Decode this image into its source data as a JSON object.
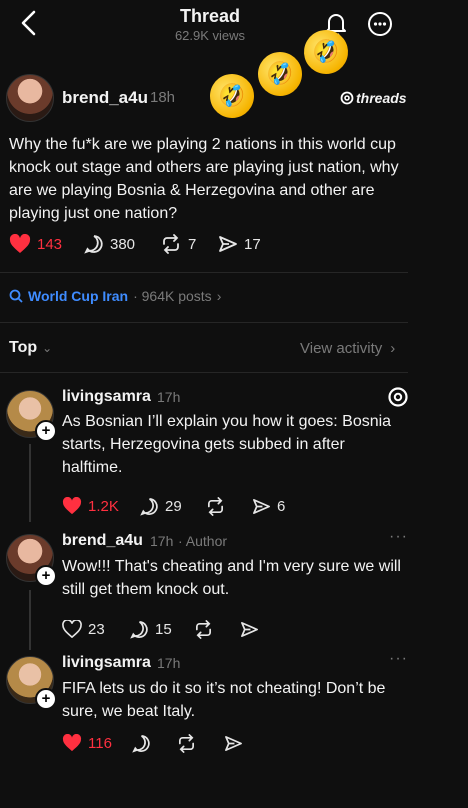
{
  "header": {
    "title": "Thread",
    "views": "62.9K views"
  },
  "post": {
    "username": "brend_a4u",
    "time": "18h",
    "brand": "threads",
    "text": "Why the fu*k are we playing 2 nations in this world cup knock out stage and others are playing just nation, why are we playing Bosnia & Herzegovina and other are playing just one nation?",
    "likes": "143",
    "replies": "380",
    "reposts": "7",
    "shares": "17",
    "emojis": [
      "🤣",
      "🤣",
      "🤣"
    ]
  },
  "topic": {
    "label": "World Cup Iran",
    "count": "· 964K posts"
  },
  "sort": {
    "label": "Top",
    "activity": "View activity"
  },
  "comments": [
    {
      "username": "livingsamra",
      "time": "17h",
      "text": "As Bosnian I’ll explain you how it goes: Bosnia starts, Herzegovina gets subbed in after halftime.",
      "likes": "1.2K",
      "replies": "29",
      "shares": "6"
    },
    {
      "username": "brend_a4u",
      "time": "17h",
      "tag": "· Author",
      "text": "Wow!!! That's cheating and I'm very sure we will still get them knock out.",
      "likes": "23",
      "replies": "15"
    },
    {
      "username": "livingsamra",
      "time": "17h",
      "text": "FIFA lets us do it so it’s not cheating! Don’t be sure, we beat Italy.",
      "likes": "116"
    }
  ],
  "icons": {
    "back": "back-chevron-icon",
    "bell": "bell-icon",
    "more": "more-icon",
    "heart": "heart-icon",
    "reply": "reply-icon",
    "repost": "repost-icon",
    "share": "share-icon",
    "search": "search-icon",
    "threads_logo": "threads-logo-icon"
  },
  "colors": {
    "background": "#0f0f0f",
    "like_red": "#ff3040",
    "link_blue": "#3f8cff"
  }
}
